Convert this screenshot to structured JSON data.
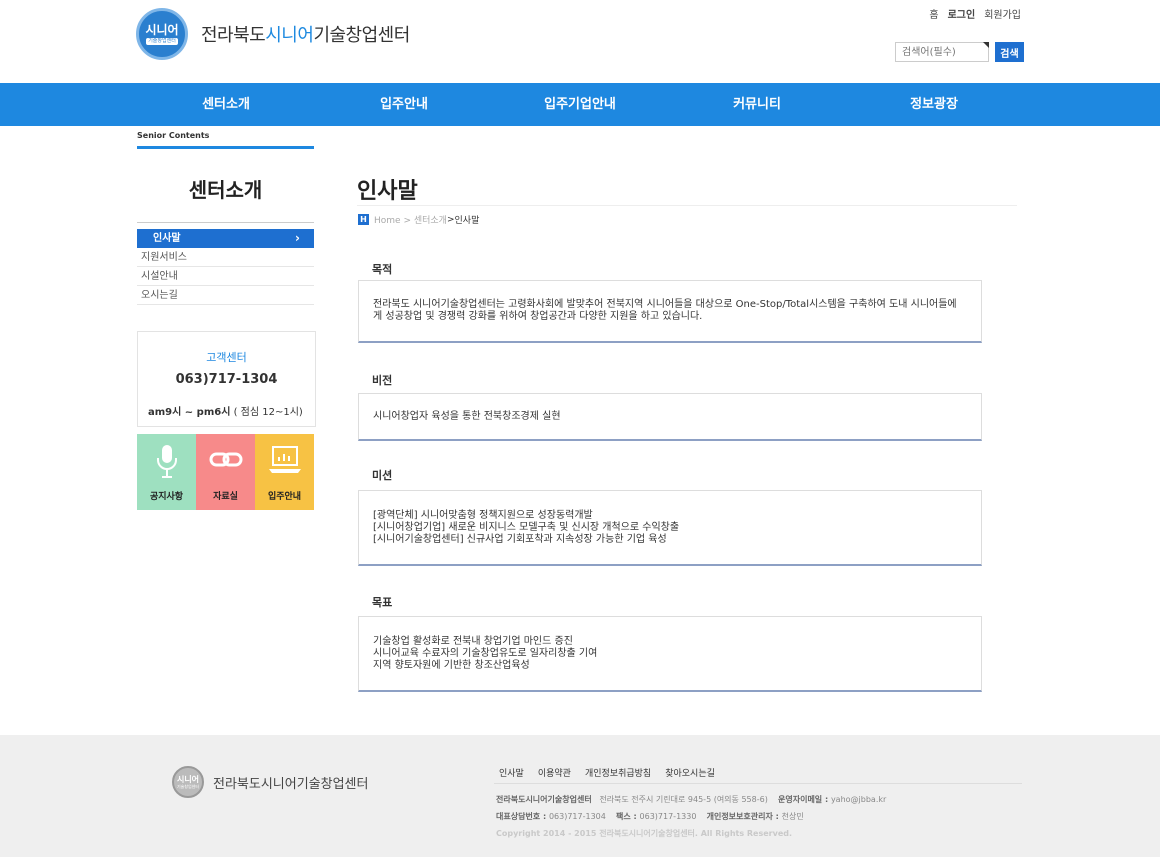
{
  "header": {
    "logo_badge_top": "시니어",
    "logo_badge_bottom": "기술창업센터",
    "logo_text_pre": "전라북도",
    "logo_text_hl": "시니어",
    "logo_text_post": "기술창업센터",
    "top_links": [
      "홈",
      "로그인",
      "회원가입"
    ],
    "search_placeholder": "검색어(필수)",
    "search_button": "검색"
  },
  "nav": [
    "센터소개",
    "입주안내",
    "입주기업안내",
    "커뮤니티",
    "정보광장"
  ],
  "sidebar": {
    "section_label": "Senior Contents",
    "title": "센터소개",
    "menu": [
      {
        "label": "인사말",
        "active": true
      },
      {
        "label": "지원서비스",
        "active": false
      },
      {
        "label": "시설안내",
        "active": false
      },
      {
        "label": "오시는길",
        "active": false
      }
    ],
    "customer_center": {
      "title": "고객센터",
      "phone": "063)717-1304",
      "hours_bold": "am9시 ~ pm6시",
      "hours_rest": " ( 점심 12~1시)"
    },
    "tiles": [
      {
        "label": "공지사항",
        "color": "#9ee0c0",
        "icon": "microphone-icon"
      },
      {
        "label": "자료실",
        "color": "#f78a8a",
        "icon": "link-icon"
      },
      {
        "label": "입주안내",
        "color": "#f7c244",
        "icon": "laptop-chart-icon"
      }
    ]
  },
  "main": {
    "title": "인사말",
    "breadcrumb": {
      "home_icon": "H",
      "path": "Home > 센터소개",
      "separator": " > ",
      "current": "인사말"
    },
    "sections": [
      {
        "title": "목적",
        "lines": [
          "전라북도 시니어기술창업센터는 고령화사회에 발맞추어 전북지역 시니어들을 대상으로 One-Stop/Total시스템을 구축하여 도내 시니어들에",
          "게 성공창업 및 경쟁력 강화를 위하여 창업공간과 다양한 지원을 하고 있습니다."
        ]
      },
      {
        "title": "비전",
        "lines": [
          "시니어창업자 육성을 통한 전북창조경제 실현"
        ]
      },
      {
        "title": "미션",
        "lines": [
          "[광역단체] 시니어맞춤형 정책지원으로 성장동력개발",
          "[시니어창업기업] 새로운 비지니스 모델구축 및 신시장 개척으로 수익창출",
          "[시니어기술창업센터] 신규사업 기회포착과 지속성장 가능한 기업 육성"
        ]
      },
      {
        "title": "목표",
        "lines": [
          "기술창업 활성화로 전북내 창업기업 마인드 증진",
          "시니어교육 수료자의 기술창업유도로 일자리창출 기여",
          "지역 향토자원에 기반한 창조산업육성"
        ]
      }
    ]
  },
  "footer": {
    "logo_badge_top": "시니어",
    "logo_badge_bottom": "기술창업센터",
    "logo_text": "전라북도시니어기술창업센터",
    "links": [
      "인사말",
      "이용약관",
      "개인정보취급방침",
      "찾아오시는길"
    ],
    "org_name": "전라북도시니어기술창업센터",
    "address": "전라북도 전주시 기린대로 945-5 (여의동 558-6)",
    "email_label": "운영자이메일 : ",
    "email": "yaho@jbba.kr",
    "phone_label": "대표상담번호 : ",
    "phone": "063)717-1304",
    "fax_label": "팩스 : ",
    "fax": "063)717-1330",
    "privacy_label": "개인정보보호관리자 : ",
    "privacy_name": "천상민",
    "copyright": "Copyright 2014 - 2015 전라북도시니어기술창업센터. All Rights Reserved."
  }
}
